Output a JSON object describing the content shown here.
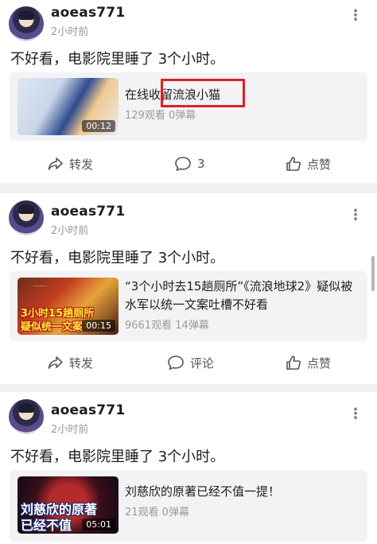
{
  "posts": [
    {
      "username": "aoeas771",
      "time": "2小时前",
      "content": "不好看，电影院里睡了 3个小时。",
      "video": {
        "title": "在线收留流浪小猫",
        "stats": "129观看 0弹幕",
        "duration": "00:12",
        "thumb_text": ""
      },
      "actions": {
        "share": "转发",
        "comment": "3",
        "like": "点赞"
      }
    },
    {
      "username": "aoeas771",
      "time": "2小时前",
      "content": "不好看，电影院里睡了 3个小时。",
      "video": {
        "title": "“3个小时去15趟厕所”《流浪地球2》疑似被水军以统一文案吐槽不好看",
        "stats": "9661观看 14弹幕",
        "duration": "00:15",
        "thumb_text_line1": "3小时15趟厕所",
        "thumb_text_line2": "疑似统一文案"
      },
      "actions": {
        "share": "转发",
        "comment": "评论",
        "like": "点赞"
      }
    },
    {
      "username": "aoeas771",
      "time": "2小时前",
      "content": "不好看，电影院里睡了 3个小时。",
      "video": {
        "title": "刘慈欣的原著已经不值一提！",
        "stats": "21观看 0弹幕",
        "duration": "05:01",
        "thumb_text_line1": "刘慈欣的原著",
        "thumb_text_line2": "已经不值"
      },
      "actions": {}
    }
  ],
  "colors": {
    "highlight": "#e02020",
    "background": "#f1f1f3"
  }
}
